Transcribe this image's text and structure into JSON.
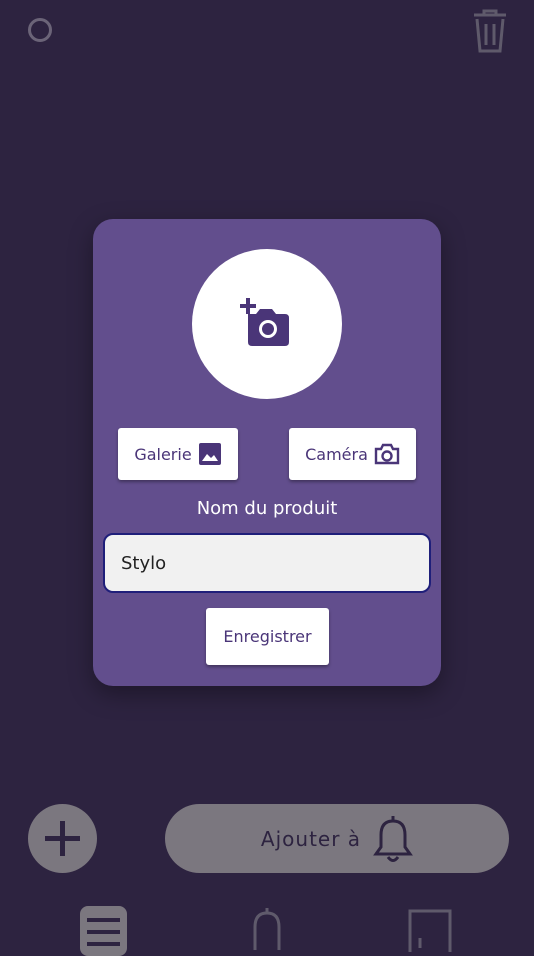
{
  "header": {
    "status_icon": "circle-outline-icon",
    "delete_icon": "trash-icon"
  },
  "modal": {
    "photo_icon": "add-photo-camera-icon",
    "gallery_button": {
      "label": "Galerie",
      "icon": "image-icon"
    },
    "camera_button": {
      "label": "Caméra",
      "icon": "camera-icon"
    },
    "product_name_label": "Nom du produit",
    "product_name_value": "Stylo",
    "save_button": "Enregistrer"
  },
  "bottom": {
    "add_icon": "plus-icon",
    "add_to_label": "Ajouter à",
    "add_to_icon": "bell-icon"
  },
  "nav": {
    "items": [
      {
        "icon": "list-icon",
        "active": true
      },
      {
        "icon": "bell-icon",
        "active": false
      },
      {
        "icon": "door-icon",
        "active": false
      }
    ]
  },
  "colors": {
    "background": "#2d2340",
    "modal": "#624e8d",
    "accent_text": "#4a3578",
    "disabled_gray": "#7b777f"
  }
}
